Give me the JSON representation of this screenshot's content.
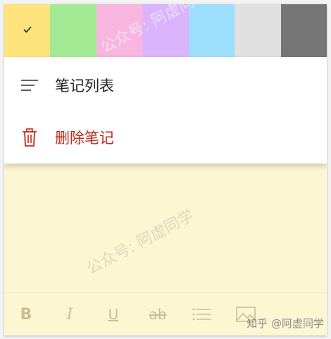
{
  "swatches": [
    {
      "name": "yellow",
      "color": "#fce37b",
      "selected": true
    },
    {
      "name": "green",
      "color": "#a4ea94"
    },
    {
      "name": "pink",
      "color": "#f7b5df"
    },
    {
      "name": "purple",
      "color": "#d9b4fd"
    },
    {
      "name": "blue",
      "color": "#9edefd"
    },
    {
      "name": "gray",
      "color": "#e0e0e0"
    },
    {
      "name": "charcoal",
      "color": "#767676"
    }
  ],
  "menu": {
    "notes_list_label": "笔记列表",
    "delete_label": "删除笔记"
  },
  "toolbar": {
    "bold": "B",
    "italic": "I",
    "underline": "U",
    "strikethrough": "ab"
  },
  "watermark": {
    "top": "公众号: 阿虚同学",
    "mid": "公众号: 阿虚同学"
  },
  "credit": "知乎 @阿虚同学"
}
